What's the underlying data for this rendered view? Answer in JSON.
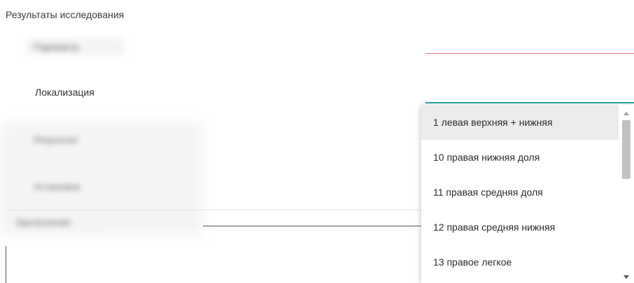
{
  "form": {
    "section_title": "Результаты исследования",
    "localization_label": "Локализация",
    "blurred_labels": [
      "Параметр",
      "Результат",
      "Устано­вка",
      "Заключение"
    ]
  },
  "dropdown": {
    "items": [
      {
        "label": "1 левая верхняя + нижняя",
        "highlighted": true
      },
      {
        "label": "10 правая нижняя доля",
        "highlighted": false
      },
      {
        "label": "11 правая средняя доля",
        "highlighted": false
      },
      {
        "label": "12 правая средняя нижняя",
        "highlighted": false
      },
      {
        "label": "13 правое легкое",
        "highlighted": false
      }
    ]
  },
  "colors": {
    "active_underline": "#26a69a",
    "error_underline": "#e57373",
    "highlight_bg": "#ececec"
  }
}
